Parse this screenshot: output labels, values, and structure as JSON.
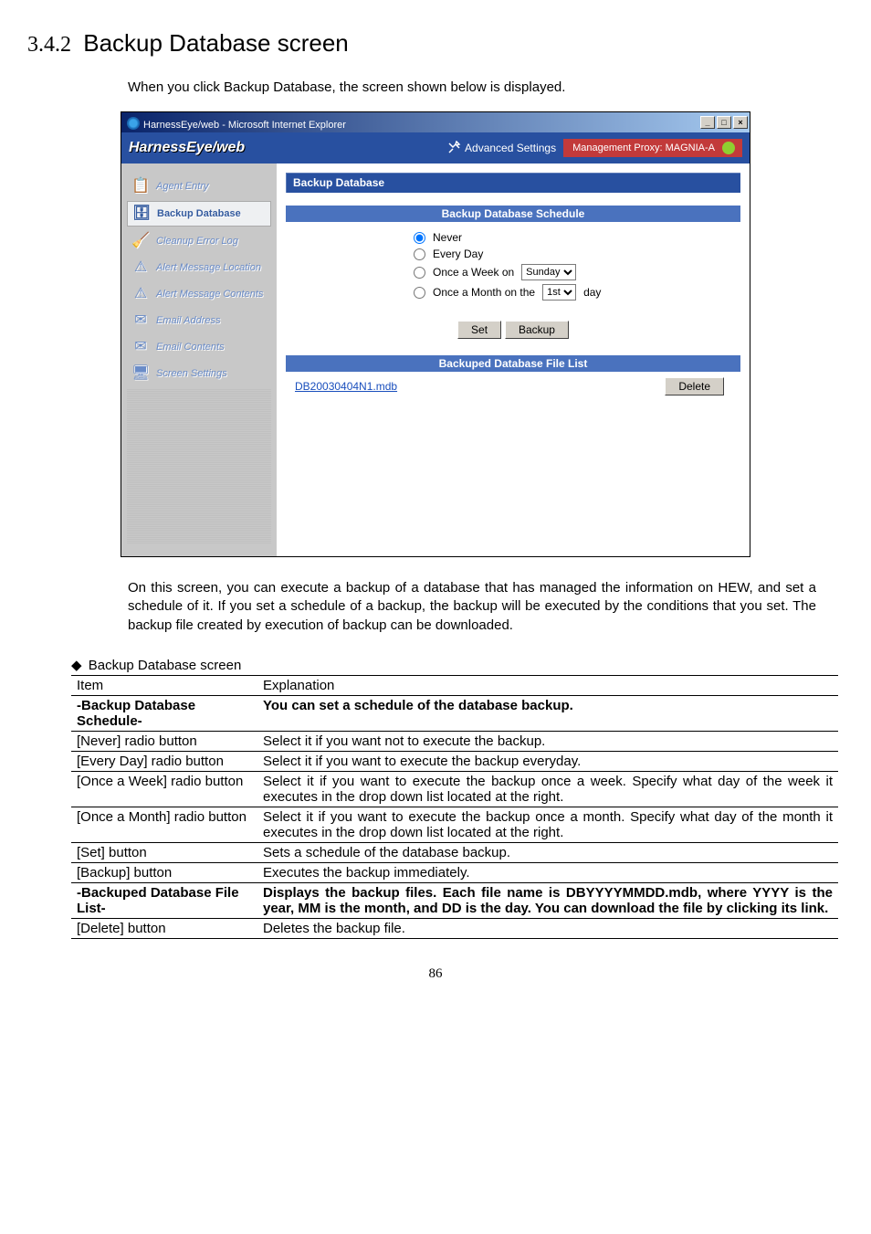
{
  "section": {
    "number": "3.4.2",
    "title": "Backup Database screen"
  },
  "intro": "When you click Backup Database, the screen shown below is displayed.",
  "window": {
    "title": "HarnessEye/web - Microsoft Internet Explorer",
    "min": "_",
    "max": "□",
    "close": "×",
    "logo": "HarnessEye/web",
    "adv_settings": "Advanced Settings",
    "proxy_label": "Management Proxy: MAGNIA-A"
  },
  "sidebar": {
    "items": [
      {
        "label": "Agent Entry",
        "icon": "📋"
      },
      {
        "label": "Backup Database",
        "icon": "🗄",
        "active": true
      },
      {
        "label": "Cleanup Error Log",
        "icon": "🧹"
      },
      {
        "label": "Alert Message Location",
        "icon": "⚠"
      },
      {
        "label": "Alert Message Contents",
        "icon": "⚠"
      },
      {
        "label": "Email Address",
        "icon": "✉"
      },
      {
        "label": "Email Contents",
        "icon": "✉"
      },
      {
        "label": "Screen Settings",
        "icon": "🖥"
      }
    ]
  },
  "panel": {
    "title": "Backup Database",
    "schedule_heading": "Backup Database Schedule",
    "radio_never": "Never",
    "radio_every": "Every Day",
    "radio_week": "Once a Week on",
    "radio_month_pre": "Once a Month on the",
    "radio_month_post": "day",
    "week_selected": "Sunday",
    "month_selected": "1st",
    "set_btn": "Set",
    "backup_btn": "Backup",
    "file_list_heading": "Backuped Database File List",
    "file_name": "DB20030404N1.mdb",
    "delete_btn": "Delete"
  },
  "description": "On this screen, you can execute a backup of a database that has managed the information on HEW, and set a schedule of it. If you set a schedule of a backup, the backup will be executed by the conditions that you set. The backup file created by execution of backup can be downloaded.",
  "table": {
    "caption_prefix": "Backup Database",
    "caption_suffix": " screen",
    "head_item": "Item",
    "head_exp": "Explanation",
    "rows": [
      {
        "item": "-Backup Database Schedule-",
        "exp": "You can set a schedule of the database backup.",
        "bold": true,
        "indent": true
      },
      {
        "item": "[Never] radio button",
        "exp": "Select it if you want not to execute the backup."
      },
      {
        "item": "[Every Day] radio button",
        "exp": "Select it if you want to execute the backup everyday."
      },
      {
        "item": "[Once a Week] radio button",
        "exp": "Select it if you want to execute the backup once a week. Specify what day of the week it executes in the drop down list located at the right.",
        "justify": true
      },
      {
        "item": "[Once a Month] radio button",
        "exp": "Select it if you want to execute the backup once a month. Specify what day of the month it executes in the drop down list located at the right.",
        "justify": true
      },
      {
        "item": "[Set] button",
        "exp": "Sets a schedule of the database backup."
      },
      {
        "item": "[Backup] button",
        "exp": "Executes the backup immediately."
      },
      {
        "item": "-Backuped Database File List-",
        "exp": "Displays the backup files. Each file name is DBYYYYMMDD.mdb, where YYYY is the year, MM is the month, and DD is the day. You can download the file by clicking its link.",
        "bold": true,
        "indent": true,
        "justify": true
      },
      {
        "item": "[Delete] button",
        "exp": "Deletes the backup file."
      }
    ]
  },
  "page_number": "86"
}
